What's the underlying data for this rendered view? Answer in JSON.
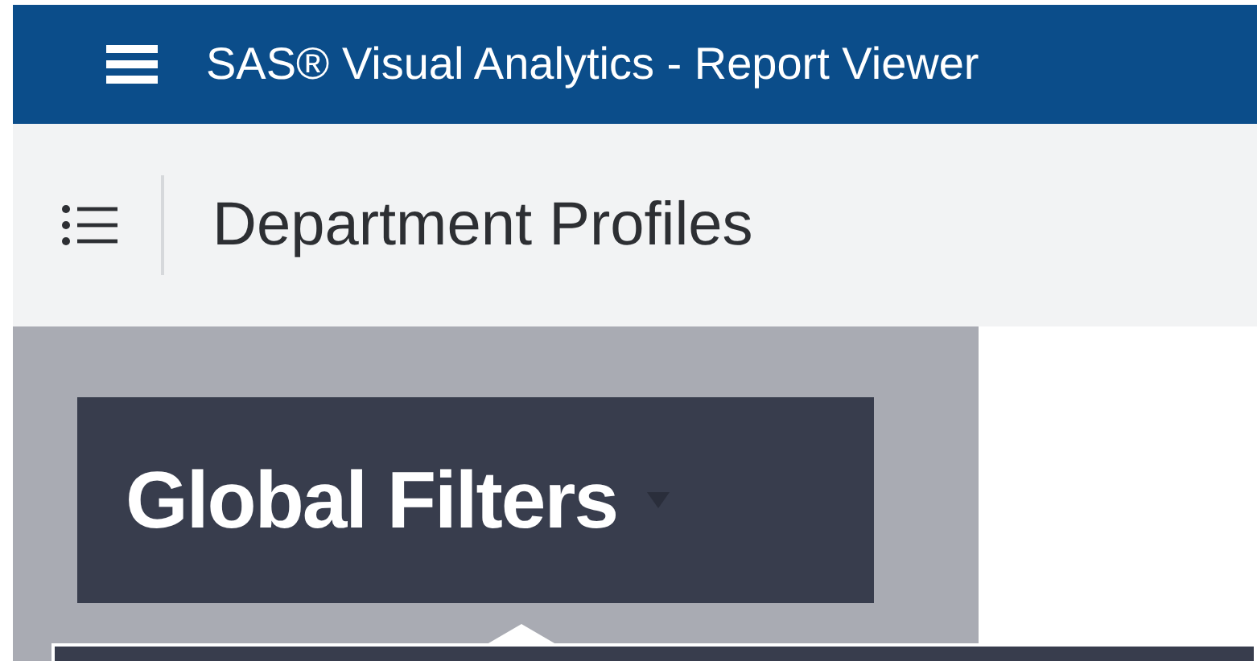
{
  "app_bar": {
    "title": "SAS® Visual Analytics - Report Viewer"
  },
  "report_bar": {
    "title": "Department Profiles"
  },
  "filter_panel": {
    "button_label": "Global Filters"
  }
}
